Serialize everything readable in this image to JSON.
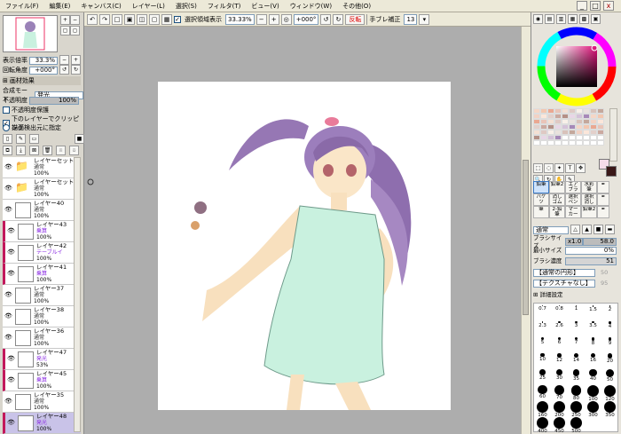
{
  "menu": [
    "ファイル(F)",
    "編集(E)",
    "キャンバス(C)",
    "レイヤー(L)",
    "選択(S)",
    "フィルタ(T)",
    "ビュー(V)",
    "ウィンドウ(W)",
    "その他(O)"
  ],
  "window_buttons": {
    "minimize": "_",
    "restore": "□",
    "close": "x"
  },
  "toolbar": {
    "select_source_label": "選択領域表示",
    "zoom": "33.33%",
    "angle": "+000°",
    "flip_label": "反転",
    "stabilizer_label": "手ブレ補正",
    "stabilizer_value": "13"
  },
  "navigator": {
    "zoom_label": "表示倍率",
    "zoom_value": "33.3%",
    "angle_label": "回転角度",
    "angle_value": "+000°"
  },
  "layer_panel": {
    "effects_label": "画材効果",
    "blend_label": "合成モード",
    "blend_value": "発光",
    "opacity_label": "不透明度",
    "opacity_value": "100%",
    "protect_label": "不透明度保護",
    "clip_label": "下のレイヤーでクリッピング",
    "source_label": "描画検出元に指定",
    "layers": [
      {
        "name": "レイヤーセット3",
        "mode": "通常",
        "pct": "100%",
        "folder": true,
        "color": ""
      },
      {
        "name": "レイヤーセット4",
        "mode": "通常",
        "pct": "100%",
        "folder": true,
        "color": ""
      },
      {
        "name": "レイヤー40",
        "mode": "通常",
        "pct": "100%",
        "folder": false,
        "color": ""
      },
      {
        "name": "レイヤー43",
        "mode": "乗算",
        "pct": "100%",
        "folder": false,
        "color": "purple"
      },
      {
        "name": "レイヤー42",
        "mode": "テーブルイ",
        "pct": "100%",
        "folder": false,
        "color": "purple"
      },
      {
        "name": "レイヤー41",
        "mode": "乗算",
        "pct": "100%",
        "folder": false,
        "color": "purple"
      },
      {
        "name": "レイヤー37",
        "mode": "通常",
        "pct": "100%",
        "folder": false,
        "color": ""
      },
      {
        "name": "レイヤー38",
        "mode": "通常",
        "pct": "100%",
        "folder": false,
        "color": ""
      },
      {
        "name": "レイヤー36",
        "mode": "通常",
        "pct": "100%",
        "folder": false,
        "color": ""
      },
      {
        "name": "レイヤー47",
        "mode": "発光",
        "pct": "53%",
        "folder": false,
        "color": "purple"
      },
      {
        "name": "レイヤー45",
        "mode": "乗算",
        "pct": "100%",
        "folder": false,
        "color": "purple"
      },
      {
        "name": "レイヤー35",
        "mode": "通常",
        "pct": "100%",
        "folder": false,
        "color": ""
      },
      {
        "name": "レイヤー48",
        "mode": "発光",
        "pct": "100%",
        "folder": false,
        "color": "purple"
      },
      {
        "name": "レイヤー46",
        "mode": "",
        "pct": "",
        "folder": false,
        "color": ""
      }
    ]
  },
  "tools": [
    [
      "鉛筆",
      "鉛筆2",
      "エアブラシ",
      "水彩筆"
    ],
    [
      "バケツ",
      "消しゴム",
      "選択ペン",
      "選択消し"
    ],
    [
      "筆",
      "2-鉛筆",
      "マーカー",
      "鉛筆2"
    ]
  ],
  "brush": {
    "mode_value": "通常",
    "size_label": "ブラシサイズ",
    "size_mult": "x1.0",
    "size_value": "58.0",
    "min_label": "最小サイズ",
    "min_value": "0%",
    "density_label": "ブラシ濃度",
    "density_value": "51",
    "shape_value": "【通常の円形】",
    "shape_num": "50",
    "texture_value": "【テクスチャなし】",
    "texture_num": "95",
    "detail_label": "詳細設定",
    "sizes": [
      "0.7",
      "0.8",
      "1",
      "1.5",
      "2",
      "2.3",
      "2.6",
      "3",
      "3.5",
      "4",
      "5",
      "6",
      "7",
      "8",
      "9",
      "10",
      "12",
      "14",
      "16",
      "20",
      "25",
      "30",
      "35",
      "40",
      "50",
      "60",
      "70",
      "80",
      "100",
      "120",
      "160",
      "200",
      "250",
      "300",
      "350",
      "400",
      "450",
      "500"
    ]
  },
  "colors": {
    "accent": "#3a78c4",
    "fg": "#3a1818",
    "bg": "#f6dcea"
  }
}
